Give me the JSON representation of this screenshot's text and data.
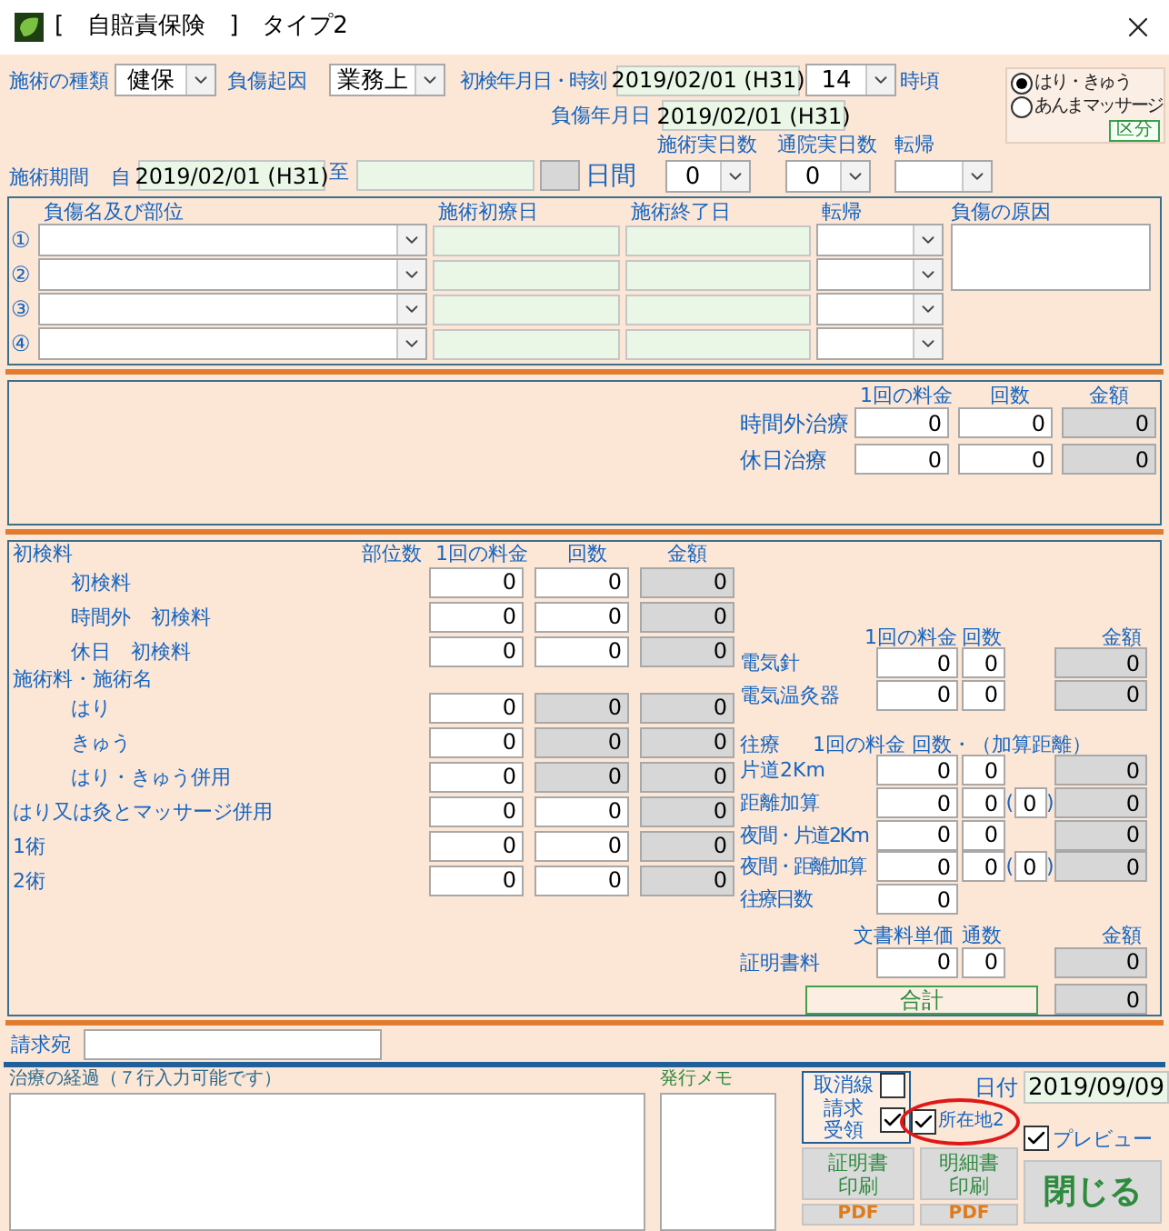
{
  "window": {
    "title": "[　自賠責保険　]　タイプ2"
  },
  "header": {
    "treatment_type": {
      "label": "施術の種類",
      "value": "健保"
    },
    "injury_cause": {
      "label": "負傷起因",
      "value": "業務上"
    },
    "first_visit": {
      "label": "初検年月日・時刻",
      "date": "2019/02/01 (H31)",
      "hour": "14",
      "suffix": "時頃"
    },
    "injury_date": {
      "label": "負傷年月日",
      "value": "2019/02/01 (H31)"
    },
    "period": {
      "label": "施術期間",
      "from_label": "自",
      "from": "2019/02/01 (H31)",
      "to_label": "至",
      "days_label": "日間"
    },
    "counts": [
      {
        "label": "施術実日数",
        "value": "0"
      },
      {
        "label": "通院実日数",
        "value": "0"
      },
      {
        "label": "転帰"
      }
    ],
    "category": {
      "options": [
        {
          "label": "はり・きゅう",
          "selected": true
        },
        {
          "label": "あんまマッサージ",
          "selected": false
        }
      ],
      "button": "区分"
    }
  },
  "injuries": {
    "columns": [
      "負傷名及び部位",
      "施術初療日",
      "施術終了日",
      "転帰",
      "負傷の原因"
    ],
    "rows": [
      {
        "marker": "①"
      },
      {
        "marker": "②"
      },
      {
        "marker": "③"
      },
      {
        "marker": "④"
      }
    ]
  },
  "overtime": {
    "columns": [
      "1回の料金",
      "回数",
      "金額"
    ],
    "rows": [
      {
        "label": "時間外治療",
        "fee": "0",
        "count": "0",
        "amount": "0"
      },
      {
        "label": "休日治療",
        "fee": "0",
        "count": "0",
        "amount": "0"
      }
    ]
  },
  "fees": {
    "columns": [
      "部位数",
      "1回の料金",
      "回数",
      "金額"
    ],
    "groups": [
      {
        "title": "初検料",
        "rows": [
          {
            "label": "初検料",
            "fee": "0",
            "count": "0",
            "count_disabled": false,
            "amount": "0"
          },
          {
            "label": "時間外　初検料",
            "fee": "0",
            "count": "0",
            "count_disabled": false,
            "amount": "0"
          },
          {
            "label": "休日　初検料",
            "fee": "0",
            "count": "0",
            "count_disabled": false,
            "amount": "0"
          }
        ]
      },
      {
        "title": "施術料・施術名",
        "rows": [
          {
            "label": "はり",
            "fee": "0",
            "count": "0",
            "count_disabled": true,
            "amount": "0"
          },
          {
            "label": "きゅう",
            "fee": "0",
            "count": "0",
            "count_disabled": true,
            "amount": "0"
          },
          {
            "label": "はり・きゅう併用",
            "fee": "0",
            "count": "0",
            "count_disabled": true,
            "amount": "0"
          }
        ]
      },
      {
        "rows": [
          {
            "label": "はり又は灸とマッサージ併用",
            "fee": "0",
            "count": "0",
            "count_disabled": false,
            "amount": "0"
          },
          {
            "label": "1術",
            "fee": "0",
            "count": "0",
            "count_disabled": false,
            "amount": "0"
          },
          {
            "label": "2術",
            "fee": "0",
            "count": "0",
            "count_disabled": false,
            "amount": "0"
          }
        ]
      }
    ]
  },
  "electric": {
    "columns": [
      "1回の料金",
      "回数",
      "金額"
    ],
    "rows": [
      {
        "label": "電気針",
        "fee": "0",
        "count": "0",
        "amount": "0"
      },
      {
        "label": "電気温灸器",
        "fee": "0",
        "count": "0",
        "amount": "0"
      }
    ]
  },
  "travel": {
    "title": "往療",
    "columns": "1回の料金 回数・（加算距離）",
    "rows": [
      {
        "label": "片道2Km",
        "fee": "0",
        "count": "0",
        "amount": "0"
      },
      {
        "label": "距離加算",
        "fee": "0",
        "count": "0",
        "distance": {
          "open": "(",
          "value": "0",
          "close": ")"
        },
        "amount": "0"
      },
      {
        "label": "夜間・片道2Km",
        "fee": "0",
        "count": "0",
        "amount": "0"
      },
      {
        "label": "夜間・距離加算",
        "fee": "0",
        "count": "0",
        "distance": {
          "open": "(",
          "value": "0",
          "close": ")"
        },
        "amount": "0"
      },
      {
        "label": "往療日数",
        "fee": "0"
      }
    ]
  },
  "documents": {
    "columns": [
      "文書料単価",
      "通数",
      "金額"
    ],
    "rows": [
      {
        "label": "証明書料",
        "fee": "0",
        "count": "0",
        "amount": "0"
      }
    ],
    "total": {
      "label": "合計",
      "value": "0"
    }
  },
  "billing": {
    "label": "請求宛"
  },
  "progress": {
    "label": "治療の経過（７行入力可能です）"
  },
  "memo": {
    "label": "発行メモ"
  },
  "print_options": [
    {
      "lines": [
        "取消線"
      ],
      "checked": false
    },
    {
      "lines": [
        "請求",
        "受領"
      ],
      "checked": true
    }
  ],
  "date": {
    "label": "日付",
    "value": "2019/09/09"
  },
  "address2": {
    "label": "所在地2",
    "checked": true,
    "circled": true
  },
  "preview": {
    "label": "プレビュー",
    "checked": true
  },
  "buttons": {
    "certificate": [
      "証明書",
      "印刷"
    ],
    "statement": [
      "明細書",
      "印刷"
    ],
    "pdf": [
      "PDF",
      "PDF"
    ],
    "close": "閉じる"
  }
}
